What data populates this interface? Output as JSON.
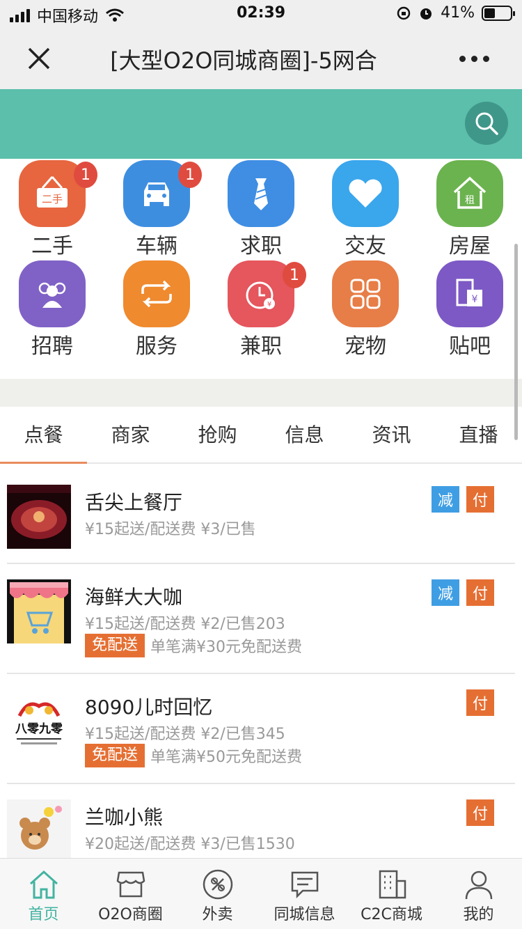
{
  "status_bar": {
    "carrier": "中国移动",
    "time": "02:39",
    "battery": "41%",
    "battery_level": 0.41
  },
  "navbar": {
    "title": "[大型O2O同城商圈]-5网合"
  },
  "categories": [
    {
      "label": "二手",
      "badge": "1",
      "color": "#e7663f"
    },
    {
      "label": "车辆",
      "badge": "1",
      "color": "#3e8ee0"
    },
    {
      "label": "求职",
      "badge": "",
      "color": "#3f8ee3"
    },
    {
      "label": "交友",
      "badge": "",
      "color": "#3aa6ec"
    },
    {
      "label": "房屋",
      "badge": "",
      "color": "#6bb34f",
      "glyph": "租"
    },
    {
      "label": "招聘",
      "badge": "",
      "color": "#8062c6"
    },
    {
      "label": "服务",
      "badge": "",
      "color": "#ef8a2f"
    },
    {
      "label": "兼职",
      "badge": "1",
      "color": "#e5565d",
      "glyph": "¥"
    },
    {
      "label": "宠物",
      "badge": "",
      "color": "#e77d47"
    },
    {
      "label": "贴吧",
      "badge": "",
      "color": "#7d59c5",
      "glyph": "¥"
    }
  ],
  "er_shou_sign": "二手",
  "tabs": [
    "点餐",
    "商家",
    "抢购",
    "信息",
    "资讯",
    "直播"
  ],
  "shops": [
    {
      "name": "舌尖上餐厅",
      "meta": "¥15起送/配送费 ¥3/已售",
      "promo_tag": "",
      "promo_desc": "",
      "has_jian": true,
      "fu": "付",
      "jian": "减"
    },
    {
      "name": "海鲜大大咖",
      "meta": "¥15起送/配送费 ¥2/已售203",
      "promo_tag": "免配送",
      "promo_desc": "单笔满¥30元免配送费",
      "has_jian": true,
      "fu": "付",
      "jian": "减"
    },
    {
      "name": "8090儿时回忆",
      "meta": "¥15起送/配送费 ¥2/已售345",
      "promo_tag": "免配送",
      "promo_desc": "单笔满¥50元免配送费",
      "has_jian": false,
      "fu": "付",
      "jian": ""
    },
    {
      "name": "兰咖小熊",
      "meta": "¥20起送/配送费 ¥3/已售1530",
      "promo_tag": "",
      "promo_desc": "",
      "has_jian": false,
      "fu": "付",
      "jian": ""
    }
  ],
  "logo_text": {
    "big": "八零九零"
  },
  "bottom_nav": [
    {
      "label": "首页",
      "icon": "home-icon"
    },
    {
      "label": "O2O商圈",
      "icon": "shop-icon"
    },
    {
      "label": "外卖",
      "icon": "takeout-icon"
    },
    {
      "label": "同城信息",
      "icon": "chat-icon"
    },
    {
      "label": "C2C商城",
      "icon": "building-icon"
    },
    {
      "label": "我的",
      "icon": "user-icon"
    }
  ]
}
